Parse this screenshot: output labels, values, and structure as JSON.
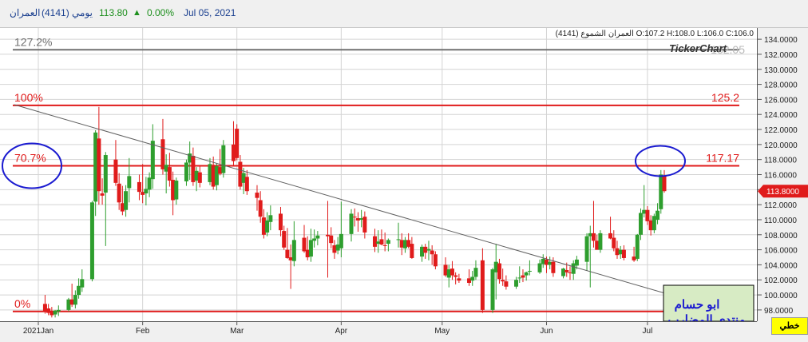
{
  "header": {
    "name": "العمران",
    "code": "(4141)",
    "period": "يومي",
    "price": "113.80",
    "change": "0.00%",
    "date": "Jul 05, 2021",
    "arrow": "▲"
  },
  "ohlc_label": "العمران الشموع (4141) O:107.2 H:108.0 L:106.0 C:106.0",
  "watermark": "TickerChart",
  "watermark_shadow": "132.05",
  "corner_label": "خطي",
  "author_line1": "ابو حسام",
  "author_line2": "منتدى المضارب",
  "colors": {
    "up": "#2e9e2e",
    "down": "#e01b1b",
    "fib": "#e01b1b",
    "trend": "#606060",
    "top_line": "#707070",
    "circle": "#1a1ad0",
    "accent_text": "#1a3f8f"
  },
  "chart_data": {
    "type": "candlestick",
    "x_dates": [
      "2021-01-03",
      "2021-07-05"
    ],
    "xlabel": "",
    "ylabel": "",
    "ylim": [
      96.5,
      135.5
    ],
    "ytick_values": [
      98,
      100,
      102,
      104,
      106,
      108,
      110,
      112,
      114,
      116,
      118,
      120,
      122,
      124,
      126,
      128,
      130,
      132,
      134
    ],
    "ytick_labels": [
      "98.0000",
      "100.0000",
      "102.0000",
      "104.0000",
      "106.0000",
      "108.0000",
      "110.0000",
      "112.0000",
      "114.0000",
      "116.0000",
      "118.0000",
      "120.0000",
      "122.0000",
      "124.0000",
      "126.0000",
      "128.0000",
      "130.0000",
      "132.0000",
      "134.0000"
    ],
    "xtick_labels": [
      "2021Jan",
      "Feb",
      "Mar",
      "Apr",
      "May",
      "Jun",
      "Jul"
    ],
    "xtick_dates": [
      "2021-01-01",
      "2021-02-01",
      "2021-03-01",
      "2021-04-01",
      "2021-05-01",
      "2021-06-01",
      "2021-07-01"
    ],
    "last_price_label": "113.8000",
    "last_price": 113.8,
    "grid": true,
    "fib_levels": [
      {
        "pct": "127.2%",
        "price": "132.05",
        "value": 132.6,
        "color": "#707070"
      },
      {
        "pct": "100%",
        "price": "125.2",
        "value": 125.2,
        "color": "#e01b1b"
      },
      {
        "pct": "70.7%",
        "price": "117.17",
        "value": 117.17,
        "color": "#e01b1b"
      },
      {
        "pct": "0%",
        "price": "97.8",
        "value": 97.8,
        "color": "#e01b1b"
      }
    ],
    "trendline": [
      [
        "2021-01-01",
        125.3
      ],
      [
        "2021-07-05",
        98.9
      ]
    ],
    "candles": [
      {
        "d": "2021-01-03",
        "o": 98.8,
        "h": 100.0,
        "l": 97.5,
        "c": 97.8
      },
      {
        "d": "2021-01-04",
        "o": 98.2,
        "h": 98.8,
        "l": 97.3,
        "c": 97.6
      },
      {
        "d": "2021-01-05",
        "o": 97.8,
        "h": 98.4,
        "l": 97.0,
        "c": 97.3
      },
      {
        "d": "2021-01-06",
        "o": 97.4,
        "h": 98.0,
        "l": 97.0,
        "c": 97.9
      },
      {
        "d": "2021-01-07",
        "o": 97.8,
        "h": 98.6,
        "l": 97.2,
        "c": 98.0
      },
      {
        "d": "2021-01-10",
        "o": 98.0,
        "h": 99.6,
        "l": 97.8,
        "c": 99.4
      },
      {
        "d": "2021-01-11",
        "o": 99.4,
        "h": 101.5,
        "l": 98.4,
        "c": 98.7
      },
      {
        "d": "2021-01-12",
        "o": 98.7,
        "h": 100.6,
        "l": 98.2,
        "c": 100.0
      },
      {
        "d": "2021-01-13",
        "o": 100.0,
        "h": 102.2,
        "l": 99.5,
        "c": 101.2
      },
      {
        "d": "2021-01-14",
        "o": 101.0,
        "h": 103.4,
        "l": 100.4,
        "c": 102.1
      },
      {
        "d": "2021-01-17",
        "o": 102.1,
        "h": 112.5,
        "l": 101.8,
        "c": 112.3
      },
      {
        "d": "2021-01-18",
        "o": 112.4,
        "h": 121.9,
        "l": 110.5,
        "c": 121.6
      },
      {
        "d": "2021-01-19",
        "o": 120.8,
        "h": 125.0,
        "l": 112.0,
        "c": 113.8
      },
      {
        "d": "2021-01-20",
        "o": 113.5,
        "h": 115.5,
        "l": 112.0,
        "c": 113.2
      },
      {
        "d": "2021-01-21",
        "o": 113.6,
        "h": 119.0,
        "l": 106.5,
        "c": 118.6
      },
      {
        "d": "2021-01-24",
        "o": 118.0,
        "h": 120.6,
        "l": 114.5,
        "c": 114.9
      },
      {
        "d": "2021-01-25",
        "o": 114.8,
        "h": 116.2,
        "l": 111.3,
        "c": 112.3
      },
      {
        "d": "2021-01-26",
        "o": 112.2,
        "h": 114.5,
        "l": 110.6,
        "c": 111.1
      },
      {
        "d": "2021-01-27",
        "o": 111.3,
        "h": 114.6,
        "l": 110.4,
        "c": 113.8
      },
      {
        "d": "2021-01-28",
        "o": 114.2,
        "h": 118.2,
        "l": 112.3,
        "c": 115.8
      },
      {
        "d": "2021-01-31",
        "o": 115.0,
        "h": 116.0,
        "l": 112.6,
        "c": 113.7
      },
      {
        "d": "2021-02-01",
        "o": 113.7,
        "h": 117.4,
        "l": 112.2,
        "c": 113.3
      },
      {
        "d": "2021-02-02",
        "o": 113.5,
        "h": 115.7,
        "l": 111.9,
        "c": 114.1
      },
      {
        "d": "2021-02-03",
        "o": 114.0,
        "h": 116.3,
        "l": 113.0,
        "c": 115.6
      },
      {
        "d": "2021-02-04",
        "o": 115.4,
        "h": 122.7,
        "l": 114.1,
        "c": 120.5
      },
      {
        "d": "2021-02-07",
        "o": 120.7,
        "h": 123.4,
        "l": 116.0,
        "c": 116.7
      },
      {
        "d": "2021-02-08",
        "o": 116.4,
        "h": 118.7,
        "l": 113.5,
        "c": 117.3
      },
      {
        "d": "2021-02-09",
        "o": 117.0,
        "h": 118.9,
        "l": 114.4,
        "c": 115.2
      },
      {
        "d": "2021-02-10",
        "o": 115.3,
        "h": 116.4,
        "l": 110.6,
        "c": 112.6
      },
      {
        "d": "2021-02-11",
        "o": 112.7,
        "h": 115.6,
        "l": 112.0,
        "c": 115.2
      },
      {
        "d": "2021-02-14",
        "o": 115.1,
        "h": 118.0,
        "l": 114.5,
        "c": 117.6
      },
      {
        "d": "2021-02-15",
        "o": 117.6,
        "h": 120.4,
        "l": 115.3,
        "c": 118.8
      },
      {
        "d": "2021-02-16",
        "o": 118.5,
        "h": 119.6,
        "l": 114.5,
        "c": 115.0
      },
      {
        "d": "2021-02-17",
        "o": 115.2,
        "h": 117.0,
        "l": 113.8,
        "c": 116.5
      },
      {
        "d": "2021-02-18",
        "o": 116.3,
        "h": 117.1,
        "l": 114.3,
        "c": 114.9
      },
      {
        "d": "2021-02-21",
        "o": 115.0,
        "h": 118.2,
        "l": 114.6,
        "c": 117.4
      },
      {
        "d": "2021-02-22",
        "o": 117.3,
        "h": 118.4,
        "l": 114.0,
        "c": 114.4
      },
      {
        "d": "2021-02-23",
        "o": 114.6,
        "h": 117.5,
        "l": 113.9,
        "c": 117.1
      },
      {
        "d": "2021-02-24",
        "o": 117.0,
        "h": 119.4,
        "l": 115.9,
        "c": 116.1
      },
      {
        "d": "2021-02-25",
        "o": 116.2,
        "h": 120.6,
        "l": 115.6,
        "c": 119.9
      },
      {
        "d": "2021-02-28",
        "o": 120.0,
        "h": 123.1,
        "l": 117.2,
        "c": 117.8
      },
      {
        "d": "2021-03-01",
        "o": 122.1,
        "h": 122.7,
        "l": 117.9,
        "c": 118.2
      },
      {
        "d": "2021-03-02",
        "o": 117.7,
        "h": 118.6,
        "l": 114.0,
        "c": 114.4
      },
      {
        "d": "2021-03-03",
        "o": 114.9,
        "h": 116.9,
        "l": 113.4,
        "c": 116.2
      },
      {
        "d": "2021-03-04",
        "o": 115.7,
        "h": 116.6,
        "l": 113.3,
        "c": 113.8
      },
      {
        "d": "2021-03-07",
        "o": 113.6,
        "h": 114.6,
        "l": 111.2,
        "c": 112.9
      },
      {
        "d": "2021-03-08",
        "o": 112.6,
        "h": 113.8,
        "l": 109.6,
        "c": 110.4
      },
      {
        "d": "2021-03-09",
        "o": 110.3,
        "h": 111.4,
        "l": 107.5,
        "c": 108.0
      },
      {
        "d": "2021-03-10",
        "o": 108.3,
        "h": 111.0,
        "l": 107.8,
        "c": 109.9
      },
      {
        "d": "2021-03-11",
        "o": 109.7,
        "h": 111.9,
        "l": 108.6,
        "c": 110.6
      },
      {
        "d": "2021-03-14",
        "o": 110.8,
        "h": 111.7,
        "l": 107.8,
        "c": 108.6
      },
      {
        "d": "2021-03-15",
        "o": 108.5,
        "h": 109.2,
        "l": 106.0,
        "c": 106.3
      },
      {
        "d": "2021-03-16",
        "o": 106.0,
        "h": 108.9,
        "l": 104.8,
        "c": 104.9
      },
      {
        "d": "2021-03-17",
        "o": 105.0,
        "h": 106.7,
        "l": 100.8,
        "c": 104.6
      },
      {
        "d": "2021-03-18",
        "o": 104.5,
        "h": 109.8,
        "l": 103.8,
        "c": 107.3
      },
      {
        "d": "2021-03-21",
        "o": 107.6,
        "h": 109.3,
        "l": 105.6,
        "c": 105.8
      },
      {
        "d": "2021-03-22",
        "o": 106.0,
        "h": 107.8,
        "l": 104.6,
        "c": 105.0
      },
      {
        "d": "2021-03-23",
        "o": 105.1,
        "h": 108.8,
        "l": 104.4,
        "c": 107.3
      },
      {
        "d": "2021-03-24",
        "o": 107.2,
        "h": 108.7,
        "l": 106.3,
        "c": 107.5
      },
      {
        "d": "2021-03-25",
        "o": 107.5,
        "h": 108.5,
        "l": 106.6,
        "c": 107.9
      },
      {
        "d": "2021-03-28",
        "o": 108.0,
        "h": 112.5,
        "l": 102.3,
        "c": 107.8
      },
      {
        "d": "2021-03-29",
        "o": 107.9,
        "h": 109.0,
        "l": 106.2,
        "c": 106.9
      },
      {
        "d": "2021-03-30",
        "o": 106.6,
        "h": 107.3,
        "l": 104.8,
        "c": 105.6
      },
      {
        "d": "2021-03-31",
        "o": 105.9,
        "h": 107.7,
        "l": 105.4,
        "c": 106.7
      },
      {
        "d": "2021-04-01",
        "o": 106.2,
        "h": 112.4,
        "l": 105.0,
        "c": 108.1
      },
      {
        "d": "2021-04-04",
        "o": 108.1,
        "h": 111.4,
        "l": 107.1,
        "c": 110.8
      },
      {
        "d": "2021-04-05",
        "o": 110.4,
        "h": 111.5,
        "l": 109.1,
        "c": 110.3
      },
      {
        "d": "2021-04-06",
        "o": 110.2,
        "h": 111.0,
        "l": 108.4,
        "c": 109.9
      },
      {
        "d": "2021-04-07",
        "o": 110.0,
        "h": 111.3,
        "l": 109.0,
        "c": 110.2
      },
      {
        "d": "2021-04-08",
        "o": 110.4,
        "h": 111.1,
        "l": 107.5,
        "c": 108.3
      },
      {
        "d": "2021-04-11",
        "o": 107.8,
        "h": 108.8,
        "l": 105.7,
        "c": 106.4
      },
      {
        "d": "2021-04-12",
        "o": 106.8,
        "h": 108.6,
        "l": 105.6,
        "c": 107.1
      },
      {
        "d": "2021-04-13",
        "o": 107.4,
        "h": 108.7,
        "l": 106.6,
        "c": 106.7
      },
      {
        "d": "2021-04-14",
        "o": 106.6,
        "h": 108.3,
        "l": 105.8,
        "c": 106.5
      },
      {
        "d": "2021-04-15",
        "o": 106.8,
        "h": 107.5,
        "l": 105.8,
        "c": 107.3
      },
      {
        "d": "2021-04-18",
        "o": 107.3,
        "h": 109.6,
        "l": 106.3,
        "c": 107.4
      },
      {
        "d": "2021-04-19",
        "o": 107.3,
        "h": 108.2,
        "l": 105.3,
        "c": 106.3
      },
      {
        "d": "2021-04-20",
        "o": 106.2,
        "h": 107.7,
        "l": 105.6,
        "c": 107.3
      },
      {
        "d": "2021-04-21",
        "o": 107.3,
        "h": 108.2,
        "l": 106.2,
        "c": 106.4
      },
      {
        "d": "2021-04-22",
        "o": 106.8,
        "h": 107.7,
        "l": 104.8,
        "c": 104.9
      },
      {
        "d": "2021-04-25",
        "o": 105.1,
        "h": 106.7,
        "l": 104.4,
        "c": 106.4
      },
      {
        "d": "2021-04-26",
        "o": 106.4,
        "h": 106.8,
        "l": 104.8,
        "c": 105.6
      },
      {
        "d": "2021-04-27",
        "o": 105.9,
        "h": 107.2,
        "l": 104.6,
        "c": 106.1
      },
      {
        "d": "2021-04-28",
        "o": 105.9,
        "h": 106.6,
        "l": 104.0,
        "c": 105.4
      },
      {
        "d": "2021-04-29",
        "o": 105.4,
        "h": 105.8,
        "l": 103.4,
        "c": 103.8
      },
      {
        "d": "2021-05-02",
        "o": 104.0,
        "h": 105.0,
        "l": 102.4,
        "c": 102.6
      },
      {
        "d": "2021-05-03",
        "o": 102.3,
        "h": 104.0,
        "l": 101.0,
        "c": 103.4
      },
      {
        "d": "2021-05-04",
        "o": 103.5,
        "h": 104.5,
        "l": 102.0,
        "c": 102.6
      },
      {
        "d": "2021-05-05",
        "o": 102.6,
        "h": 103.0,
        "l": 101.4,
        "c": 102.4
      },
      {
        "d": "2021-05-06",
        "o": 102.2,
        "h": 102.8,
        "l": 101.6,
        "c": 101.9
      },
      {
        "d": "2021-05-09",
        "o": 102.2,
        "h": 103.4,
        "l": 101.2,
        "c": 101.6
      },
      {
        "d": "2021-05-10",
        "o": 101.9,
        "h": 103.2,
        "l": 101.2,
        "c": 102.4
      },
      {
        "d": "2021-05-11",
        "o": 102.4,
        "h": 104.6,
        "l": 102.0,
        "c": 103.6
      },
      {
        "d": "2021-05-13",
        "o": 104.6,
        "h": 106.2,
        "l": 97.6,
        "c": 98.0
      },
      {
        "d": "2021-05-16",
        "o": 98.0,
        "h": 103.6,
        "l": 97.6,
        "c": 103.4
      },
      {
        "d": "2021-05-17",
        "o": 103.0,
        "h": 106.8,
        "l": 99.4,
        "c": 104.4
      },
      {
        "d": "2021-05-18",
        "o": 104.2,
        "h": 104.8,
        "l": 101.5,
        "c": 102.1
      },
      {
        "d": "2021-05-19",
        "o": 102.0,
        "h": 103.5,
        "l": 101.2,
        "c": 101.8
      },
      {
        "d": "2021-05-20",
        "o": 101.8,
        "h": 102.6,
        "l": 100.7,
        "c": 101.1
      },
      {
        "d": "2021-05-23",
        "o": 101.1,
        "h": 102.4,
        "l": 100.8,
        "c": 102.0
      },
      {
        "d": "2021-05-24",
        "o": 102.2,
        "h": 103.8,
        "l": 101.6,
        "c": 102.3
      },
      {
        "d": "2021-05-25",
        "o": 102.6,
        "h": 103.4,
        "l": 101.7,
        "c": 102.3
      },
      {
        "d": "2021-05-26",
        "o": 102.6,
        "h": 103.1,
        "l": 101.9,
        "c": 103.0
      },
      {
        "d": "2021-05-27",
        "o": 103.1,
        "h": 104.6,
        "l": 102.6,
        "c": 103.2
      },
      {
        "d": "2021-05-30",
        "o": 103.0,
        "h": 104.7,
        "l": 102.8,
        "c": 104.2
      },
      {
        "d": "2021-05-31",
        "o": 104.1,
        "h": 105.4,
        "l": 103.6,
        "c": 104.8
      },
      {
        "d": "2021-06-01",
        "o": 104.7,
        "h": 105.1,
        "l": 102.9,
        "c": 104.0
      },
      {
        "d": "2021-06-02",
        "o": 104.0,
        "h": 105.1,
        "l": 103.4,
        "c": 104.4
      },
      {
        "d": "2021-06-03",
        "o": 104.4,
        "h": 105.0,
        "l": 102.4,
        "c": 102.9
      },
      {
        "d": "2021-06-06",
        "o": 102.5,
        "h": 103.6,
        "l": 102.2,
        "c": 103.5
      },
      {
        "d": "2021-06-07",
        "o": 103.3,
        "h": 104.3,
        "l": 102.4,
        "c": 103.0
      },
      {
        "d": "2021-06-08",
        "o": 103.0,
        "h": 103.8,
        "l": 102.0,
        "c": 102.9
      },
      {
        "d": "2021-06-09",
        "o": 102.8,
        "h": 104.6,
        "l": 102.0,
        "c": 104.2
      },
      {
        "d": "2021-06-10",
        "o": 103.9,
        "h": 105.2,
        "l": 103.4,
        "c": 104.7
      },
      {
        "d": "2021-06-13",
        "o": 104.4,
        "h": 108.2,
        "l": 103.2,
        "c": 107.8
      },
      {
        "d": "2021-06-14",
        "o": 107.8,
        "h": 109.2,
        "l": 101.0,
        "c": 108.2
      },
      {
        "d": "2021-06-15",
        "o": 108.2,
        "h": 112.5,
        "l": 106.3,
        "c": 107.2
      },
      {
        "d": "2021-06-16",
        "o": 107.2,
        "h": 108.0,
        "l": 106.0,
        "c": 106.0
      },
      {
        "d": "2021-06-17",
        "o": 106.0,
        "h": 108.6,
        "l": 105.6,
        "c": 108.2
      },
      {
        "d": "2021-06-20",
        "o": 108.2,
        "h": 110.4,
        "l": 107.4,
        "c": 107.5
      },
      {
        "d": "2021-06-21",
        "o": 107.6,
        "h": 108.6,
        "l": 105.8,
        "c": 106.2
      },
      {
        "d": "2021-06-22",
        "o": 106.2,
        "h": 107.2,
        "l": 104.8,
        "c": 105.3
      },
      {
        "d": "2021-06-23",
        "o": 105.4,
        "h": 106.5,
        "l": 104.8,
        "c": 106.0
      },
      {
        "d": "2021-06-24",
        "o": 106.0,
        "h": 106.6,
        "l": 104.6,
        "c": 104.9
      },
      {
        "d": "2021-06-27",
        "o": 105.1,
        "h": 106.4,
        "l": 104.4,
        "c": 104.6
      },
      {
        "d": "2021-06-28",
        "o": 104.8,
        "h": 108.1,
        "l": 104.5,
        "c": 108.0
      },
      {
        "d": "2021-06-29",
        "o": 108.0,
        "h": 111.5,
        "l": 107.3,
        "c": 110.9
      },
      {
        "d": "2021-06-30",
        "o": 110.8,
        "h": 114.6,
        "l": 110.3,
        "c": 111.3
      },
      {
        "d": "2021-07-01",
        "o": 111.3,
        "h": 111.8,
        "l": 109.3,
        "c": 109.8
      },
      {
        "d": "2021-07-02",
        "o": 109.9,
        "h": 110.6,
        "l": 107.9,
        "c": 108.6
      },
      {
        "d": "2021-07-03",
        "o": 108.6,
        "h": 110.8,
        "l": 108.2,
        "c": 110.5
      },
      {
        "d": "2021-07-04",
        "o": 110.0,
        "h": 112.2,
        "l": 109.4,
        "c": 111.2
      },
      {
        "d": "2021-07-05",
        "o": 111.4,
        "h": 116.6,
        "l": 110.8,
        "c": 116.0
      },
      {
        "d": "2021-07-06",
        "o": 115.8,
        "h": 116.6,
        "l": 113.6,
        "c": 113.8
      }
    ]
  }
}
